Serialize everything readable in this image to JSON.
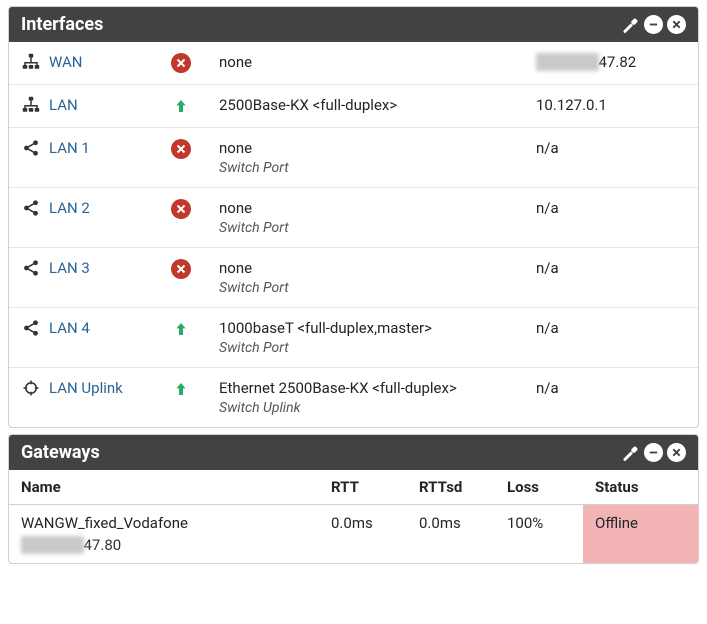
{
  "interfaces_panel": {
    "title": "Interfaces",
    "rows": [
      {
        "icon": "sitemap",
        "name": "WAN",
        "status": "down",
        "media": "none",
        "sub": "",
        "addr_blur": "xx.xx.",
        "addr": "47.82"
      },
      {
        "icon": "sitemap",
        "name": "LAN",
        "status": "up",
        "media": "2500Base-KX <full-duplex>",
        "sub": "",
        "addr_blur": "",
        "addr": "10.127.0.1"
      },
      {
        "icon": "share",
        "name": "LAN 1",
        "status": "down",
        "media": "none",
        "sub": "Switch Port",
        "addr_blur": "",
        "addr": "n/a"
      },
      {
        "icon": "share",
        "name": "LAN 2",
        "status": "down",
        "media": "none",
        "sub": "Switch Port",
        "addr_blur": "",
        "addr": "n/a"
      },
      {
        "icon": "share",
        "name": "LAN 3",
        "status": "down",
        "media": "none",
        "sub": "Switch Port",
        "addr_blur": "",
        "addr": "n/a"
      },
      {
        "icon": "share",
        "name": "LAN 4",
        "status": "up",
        "media": "1000baseT <full-duplex,master>",
        "sub": "Switch Port",
        "addr_blur": "",
        "addr": "n/a"
      },
      {
        "icon": "crosshair",
        "name": "LAN Uplink",
        "status": "up",
        "media": "Ethernet 2500Base-KX <full-duplex>",
        "sub": "Switch Uplink",
        "addr_blur": "",
        "addr": "n/a"
      }
    ]
  },
  "gateways_panel": {
    "title": "Gateways",
    "headers": {
      "name": "Name",
      "rtt": "RTT",
      "rttsd": "RTTsd",
      "loss": "Loss",
      "status": "Status"
    },
    "rows": [
      {
        "name": "WANGW_fixed_Vodafone",
        "ip_blur": "xx.xx.",
        "ip": "47.80",
        "rtt": "0.0ms",
        "rttsd": "0.0ms",
        "loss": "100%",
        "status": "Offline"
      }
    ]
  }
}
